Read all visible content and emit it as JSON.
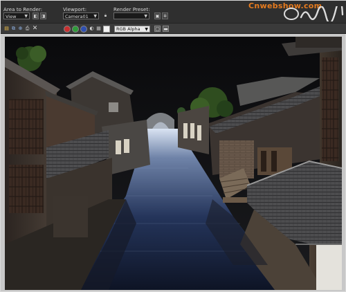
{
  "toolbar": {
    "area_label": "Area to Render:",
    "area_value": "View",
    "viewport_label": "Viewport:",
    "viewport_value": "Camera01",
    "preset_label": "Render Preset:",
    "preset_value": "",
    "channel_value": "RGB Alpha"
  },
  "brand": {
    "site": "Cnwebshow.com"
  },
  "colors": {
    "toolbar_bg": "#2f2f2f",
    "channel_red": "#c83030",
    "channel_green": "#2f9a3a",
    "channel_blue": "#2f4fb0",
    "accent_orange": "#e57a1e"
  },
  "icons": [
    "lock-icon",
    "render-icon",
    "gear-icon",
    "save-icon",
    "copy-icon",
    "clone-icon",
    "print-icon",
    "close-icon",
    "red-channel-icon",
    "green-channel-icon",
    "blue-channel-icon",
    "alpha-channel-icon",
    "mono-icon",
    "color-swatch-icon",
    "display-icon",
    "toggle-icon"
  ]
}
